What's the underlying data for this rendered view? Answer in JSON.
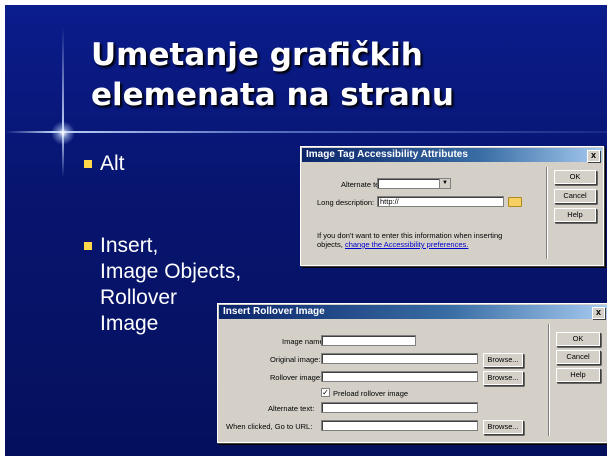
{
  "slide": {
    "title_lines": [
      "Umetanje grafičkih",
      "elemenata na stranu"
    ],
    "bullets": [
      {
        "lines": [
          "Alt"
        ]
      },
      {
        "lines": [
          "Insert,",
          "Image Objects,",
          "Rollover",
          "Image"
        ]
      }
    ]
  },
  "accessibility_dialog": {
    "title": "Image Tag Accessibility Attributes",
    "close": "x",
    "alt_label": "Alternate text:",
    "alt_value": "",
    "long_desc_label": "Long description:",
    "long_desc_value": "http://",
    "note_line1": "If you don't want to enter this information when inserting",
    "note_prefix": "objects, ",
    "note_link": "change the Accessibility preferences.",
    "ok": "OK",
    "cancel": "Cancel",
    "help": "Help"
  },
  "rollover_dialog": {
    "title": "Insert Rollover Image",
    "close": "x",
    "image_name_label": "Image name:",
    "original_label": "Original image:",
    "rollover_label": "Rollover image:",
    "preload_label": "Preload rollover image",
    "preload_checked": true,
    "alt_label": "Alternate text:",
    "url_label": "When clicked, Go to URL:",
    "browse": "Browse...",
    "ok": "OK",
    "cancel": "Cancel",
    "help": "Help"
  },
  "colors": {
    "background": "#0b1c8c",
    "bullet": "#ffd94a",
    "titlebar": "#0a246a"
  }
}
